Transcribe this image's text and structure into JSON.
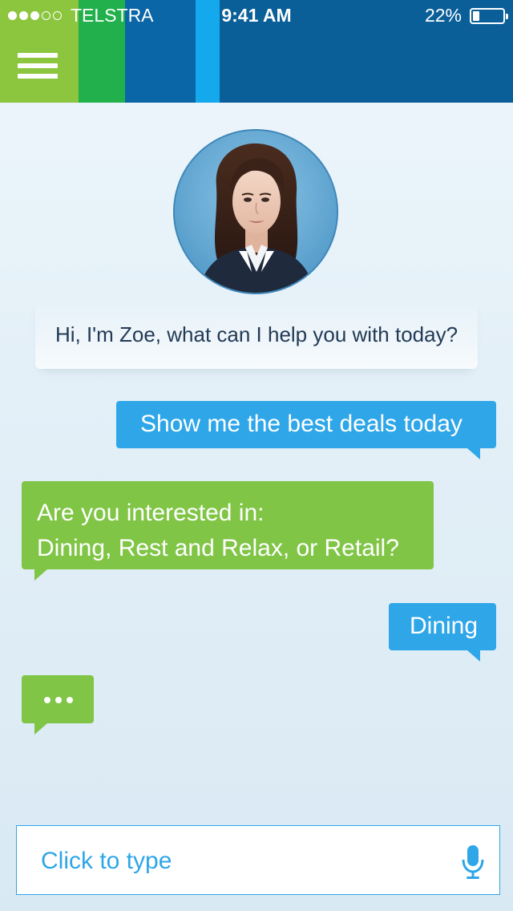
{
  "status_bar": {
    "signal_bars_filled": 3,
    "signal_bars_total": 5,
    "carrier": "TELSTRA",
    "time": "9:41 AM",
    "battery_percent": "22%"
  },
  "header": {
    "menu_icon": "hamburger-menu-icon",
    "stripe_colors": [
      "#8cc63f",
      "#21b04b",
      "#0a66a6",
      "#13a9ec",
      "#0a5f99"
    ]
  },
  "assistant": {
    "greeting": "Hi, I'm Zoe, what can I help you with today?"
  },
  "conversation": [
    {
      "from": "user",
      "text": "Show me the best deals today"
    },
    {
      "from": "assistant",
      "lines": [
        "Are you interested in:",
        "Dining, Rest and Relax, or Retail?"
      ]
    },
    {
      "from": "user",
      "text": "Dining"
    },
    {
      "from": "assistant",
      "typing": true
    }
  ],
  "input": {
    "placeholder": "Click to type",
    "mic_icon": "microphone-icon"
  },
  "colors": {
    "user_bubble": "#2ea6e8",
    "assistant_bubble": "#80c546",
    "header_blue": "#0a5f99",
    "accent_green": "#8cc63f"
  }
}
